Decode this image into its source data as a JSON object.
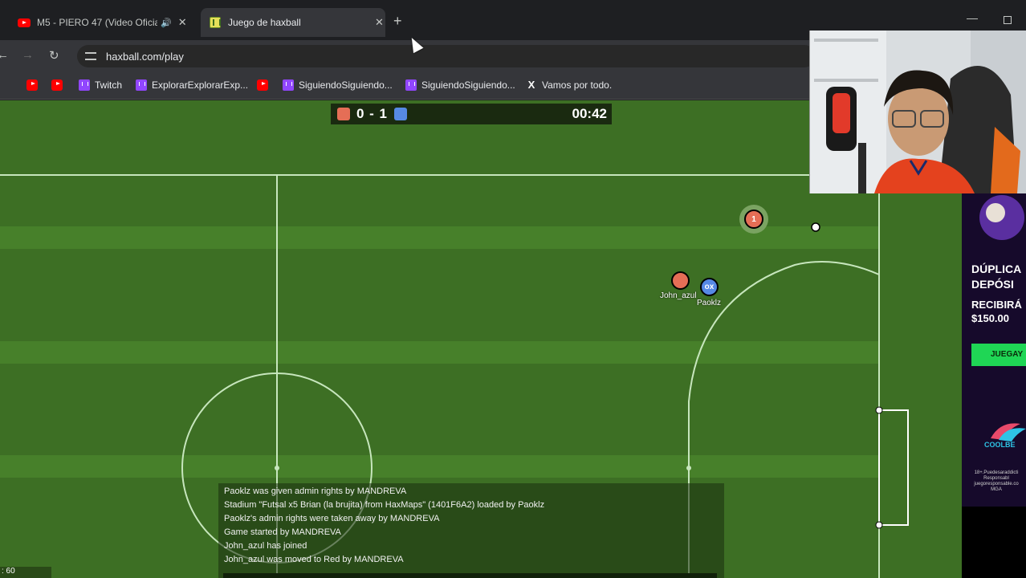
{
  "browser": {
    "tabs": [
      {
        "title": "M5 - PIERO 47 (Video Oficial)",
        "favicon": "youtube-icon",
        "active": false
      },
      {
        "title": "Juego de haxball",
        "favicon": "haxball-icon",
        "active": true
      }
    ],
    "new_tab_label": "+",
    "address": "haxball.com/play",
    "bookmarks": [
      {
        "label": "",
        "icon": "youtube-icon"
      },
      {
        "label": "",
        "icon": "youtube-icon"
      },
      {
        "label": "Twitch",
        "icon": "twitch-icon"
      },
      {
        "label": "ExplorarExplorarExp...",
        "icon": "twitch-icon"
      },
      {
        "label": "",
        "icon": "youtube-icon"
      },
      {
        "label": "SiguiendoSiguiendo...",
        "icon": "twitch-icon"
      },
      {
        "label": "SiguiendoSiguiendo...",
        "icon": "twitch-icon"
      },
      {
        "label": "Vamos por todo.",
        "icon": "x-icon"
      }
    ]
  },
  "game": {
    "score": "0 - 1",
    "timer": "00:42",
    "red_color": "#e56e56",
    "blue_color": "#5689e5",
    "players": [
      {
        "name": "John_azul",
        "team": "red",
        "avatar": ""
      },
      {
        "name": "Paoklz",
        "team": "blue",
        "avatar": "ox"
      },
      {
        "name": "",
        "team": "red",
        "avatar": "1"
      }
    ],
    "chat": [
      "Paoklz was given admin rights by MANDREVA",
      "Stadium \"Futsal x5 Brian (la brujita) from HaxMaps\" (1401F6A2) loaded by Paoklz",
      "Paoklz's admin rights were taken away by MANDREVA",
      "Game started by MANDREVA",
      "John_azul has joined",
      "John_azul was moved to Red by MANDREVA"
    ],
    "fps": ": 60"
  },
  "ad": {
    "line1": "DÚPLICA",
    "line2": "DEPÓSI",
    "line3": "RECIBIRÁ",
    "line4": "$150.00",
    "button": "JUEGAY",
    "brand": "COOLBE",
    "fine_print": "18+.Puedesaraddicti Responsabl juegoresponsable.co MGA"
  }
}
